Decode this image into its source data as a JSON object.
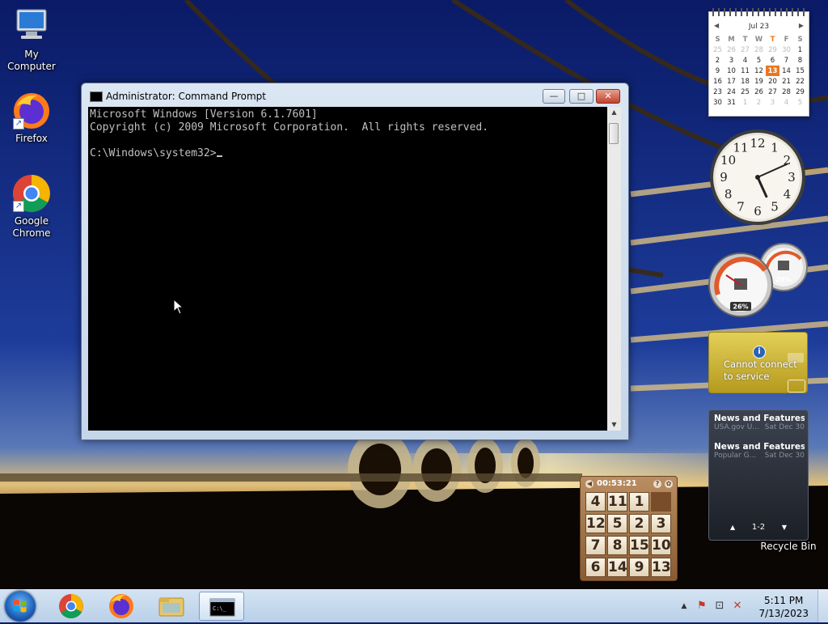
{
  "desktop": {
    "icons": [
      {
        "label": "My Computer"
      },
      {
        "label": "Firefox"
      },
      {
        "label": "Google Chrome"
      }
    ],
    "recycle_bin": "Recycle Bin"
  },
  "cmd_window": {
    "title": "Administrator: Command Prompt",
    "lines": [
      "Microsoft Windows [Version 6.1.7601]",
      "Copyright (c) 2009 Microsoft Corporation.  All rights reserved.",
      "",
      "C:\\Windows\\system32>"
    ],
    "minimize_label": "—",
    "maximize_label": "□",
    "close_label": "✕"
  },
  "calendar": {
    "month": "Jul 23",
    "weekdays": [
      "S",
      "M",
      "T",
      "W",
      "T",
      "F",
      "S"
    ],
    "today_col": 4,
    "weeks": [
      [
        "25",
        "26",
        "27",
        "28",
        "29",
        "30",
        "1"
      ],
      [
        "2",
        "3",
        "4",
        "5",
        "6",
        "7",
        "8"
      ],
      [
        "9",
        "10",
        "11",
        "12",
        "13",
        "14",
        "15"
      ],
      [
        "16",
        "17",
        "18",
        "19",
        "20",
        "21",
        "22"
      ],
      [
        "23",
        "24",
        "25",
        "26",
        "27",
        "28",
        "29"
      ],
      [
        "30",
        "31",
        "1",
        "2",
        "3",
        "4",
        "5"
      ]
    ],
    "today": "13",
    "accent": "#e87722"
  },
  "clock_gadget": {
    "numerals": [
      "12",
      "1",
      "2",
      "3",
      "4",
      "5",
      "6",
      "7",
      "8",
      "9",
      "10",
      "11"
    ],
    "hour": 5,
    "minute": 11
  },
  "cpu_meter": {
    "cpu_percent": "26%",
    "memory_percent": "29%"
  },
  "weather": {
    "info_icon": "i",
    "message": "Cannot connect to service"
  },
  "feeds": {
    "items": [
      {
        "title": "News and Features f...",
        "source": "USA.gov U...",
        "date": "Sat Dec 30"
      },
      {
        "title": "News and Features f...",
        "source": "Popular G...",
        "date": "Sat Dec 30"
      }
    ],
    "pager": "1-2",
    "up_icon": "▲",
    "down_icon": "▼"
  },
  "puzzle": {
    "timer": "00:53:21",
    "tiles": [
      "4",
      "11",
      "1",
      "",
      "12",
      "5",
      "2",
      "3",
      "7",
      "8",
      "15",
      "10",
      "6",
      "14",
      "9",
      "13"
    ]
  },
  "taskbar": {
    "clock_time": "5:11 PM",
    "clock_date": "7/13/2023",
    "tray_icons": [
      "show-hidden-icon",
      "action-center-icon",
      "network-icon",
      "volume-muted-icon"
    ],
    "tray_glyphs": {
      "show_hidden": "▲",
      "action_center": "⚑",
      "network": "⊡",
      "volume": "🔇"
    }
  }
}
